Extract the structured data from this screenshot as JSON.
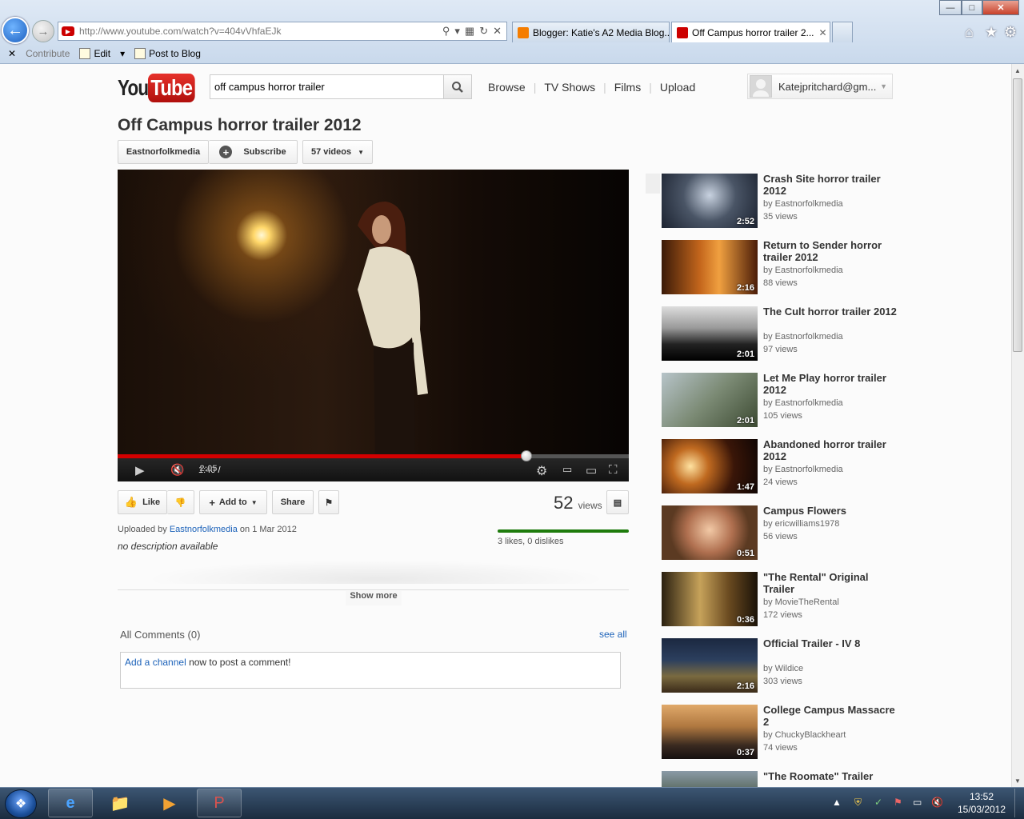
{
  "browser": {
    "url": "http://www.youtube.com/watch?v=404vVhfaEJk",
    "tabs": [
      {
        "label": "Blogger: Katie's A2 Media Blog...",
        "active": false,
        "color": "#f57d00"
      },
      {
        "label": "Off Campus horror trailer 2...",
        "active": true,
        "color": "#cc0000"
      }
    ],
    "command_bar": {
      "contribute": "Contribute",
      "edit": "Edit",
      "post_to_blog": "Post to Blog"
    }
  },
  "yt": {
    "logo_you": "You",
    "logo_tube": "Tube",
    "search_value": "off campus horror trailer",
    "nav": [
      "Browse",
      "TV Shows",
      "Films",
      "Upload"
    ],
    "user": "Katejpritchard@gm..."
  },
  "video": {
    "title": "Off Campus horror trailer 2012",
    "channel": "Eastnorfolkmedia",
    "subscribe": "Subscribe",
    "videos_count": "57 videos",
    "current_time": "1:40",
    "duration": "2:05",
    "progress": 0.8,
    "like": "Like",
    "add_to": "Add to",
    "share": "Share",
    "views_count": "52",
    "views_label": "views",
    "likes_text": "3 likes, 0 dislikes",
    "uploaded_prefix": "Uploaded by",
    "uploaded_by": "Eastnorfolkmedia",
    "uploaded_suffix": "on 1 Mar 2012",
    "description": "no description available",
    "show_more": "Show more"
  },
  "comments": {
    "header": "All Comments (0)",
    "see_all": "see all",
    "add_channel": "Add a channel",
    "prompt_suffix": "now to post a comment!"
  },
  "related": [
    {
      "title": "Crash Site horror trailer 2012",
      "by": "by Eastnorfolkmedia",
      "views": "35 views",
      "duration": "2:52"
    },
    {
      "title": "Return to Sender horror trailer 2012",
      "by": "by Eastnorfolkmedia",
      "views": "88 views",
      "duration": "2:16"
    },
    {
      "title": "The Cult horror trailer 2012",
      "by": "by Eastnorfolkmedia",
      "views": "97 views",
      "duration": "2:01"
    },
    {
      "title": "Let Me Play horror trailer 2012",
      "by": "by Eastnorfolkmedia",
      "views": "105 views",
      "duration": "2:01"
    },
    {
      "title": "Abandoned horror trailer 2012",
      "by": "by Eastnorfolkmedia",
      "views": "24 views",
      "duration": "1:47"
    },
    {
      "title": "Campus Flowers",
      "by": "by ericwilliams1978",
      "views": "56 views",
      "duration": "0:51"
    },
    {
      "title": "\"The Rental\" Original Trailer",
      "by": "by MovieTheRental",
      "views": "172 views",
      "duration": "0:36"
    },
    {
      "title": "Official Trailer - IV 8",
      "by": "by Wildice",
      "views": "303 views",
      "duration": "2:16"
    },
    {
      "title": "College Campus Massacre 2",
      "by": "by ChuckyBlackheart",
      "views": "74 views",
      "duration": "0:37"
    },
    {
      "title": "\"The Roomate\" Trailer",
      "by": "",
      "views": "",
      "duration": ""
    }
  ],
  "taskbar": {
    "time": "13:52",
    "date": "15/03/2012"
  }
}
